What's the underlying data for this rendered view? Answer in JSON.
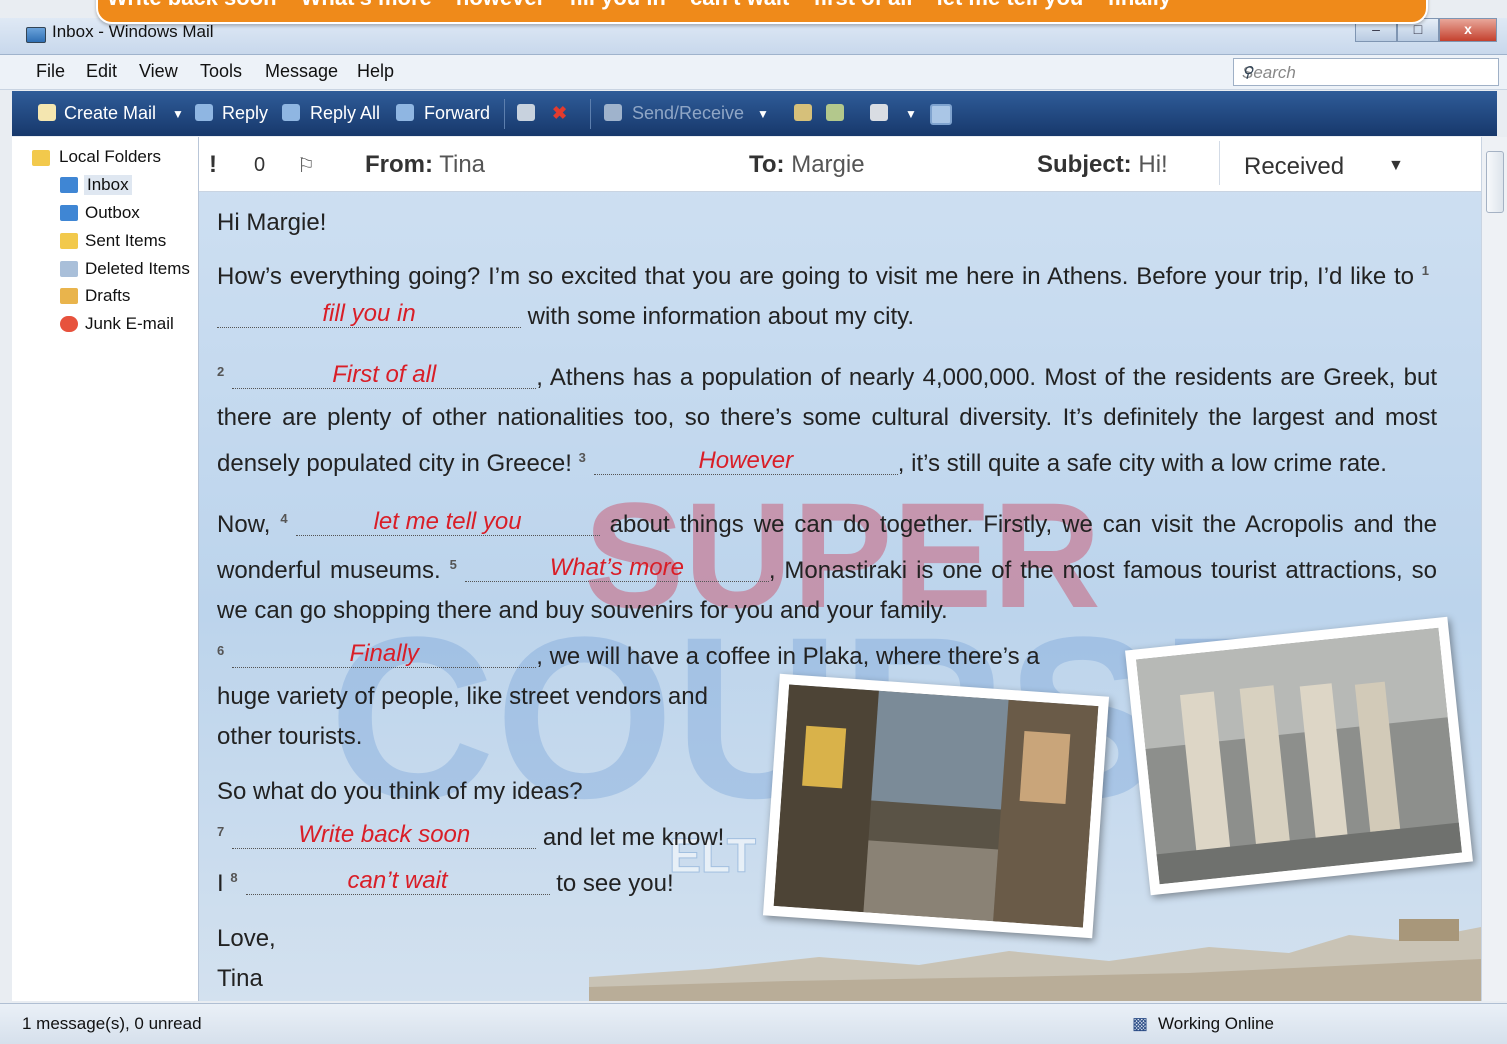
{
  "banner": {
    "items": [
      "Write back soon",
      "What's more",
      "however",
      "fill you in",
      "can't wait",
      "first of all",
      "let me tell you",
      "finally"
    ]
  },
  "window": {
    "title": "Inbox - Windows Mail",
    "buttons": {
      "minimize": "–",
      "maximize": "□",
      "close": "x"
    }
  },
  "menu": {
    "file": "File",
    "edit": "Edit",
    "view": "View",
    "tools": "Tools",
    "message": "Message",
    "help": "Help",
    "search_placeholder": "Search"
  },
  "toolbar": {
    "create_mail": "Create Mail",
    "reply": "Reply",
    "reply_all": "Reply All",
    "forward": "Forward",
    "send_receive": "Send/Receive"
  },
  "folders": {
    "root": "Local Folders",
    "items": [
      "Inbox",
      "Outbox",
      "Sent Items",
      "Deleted Items",
      "Drafts",
      "Junk E-mail"
    ]
  },
  "header": {
    "from_label": "From:",
    "from": "Tina",
    "to_label": "To:",
    "to": "Margie",
    "subject_label": "Subject:",
    "subject": "Hi!",
    "received": "Received",
    "col_importance": "!",
    "col_attachment": "0",
    "col_flag": "⚐"
  },
  "email": {
    "greeting": "Hi Margie!",
    "p1_a": "How’s everything going? I’m so excited that you are going to visit me here in Athens. Before your trip, I’d like to",
    "p1_b": "with some information about my city.",
    "p2_b": ", Athens has a population of nearly 4,000,000. Most of the residents are Greek, but there are plenty of other nationalities too, so there’s some cultural diversity. It’s definitely the largest and most densely populated city in Greece!",
    "p2_c": ", it’s still quite a safe city with a low crime rate.",
    "p3_a": "Now,",
    "p3_b": "about things we can do together. Firstly, we can visit the Acropolis and the wonderful museums.",
    "p3_c": ", Monastiraki is one of the most famous tourist attractions, so we can go shopping there and buy souvenirs for you and your family.",
    "p3_d": ", we will have a coffee in Plaka, where there’s a",
    "p3_e": "huge variety of people, like street vendors and",
    "p3_f": "other tourists.",
    "p4_a": "So what do you think of my ideas?",
    "p4_b": "and let me know!",
    "p4_c": "I",
    "p4_d": "to see you!",
    "love": "Love,",
    "sign": "Tina",
    "nums": [
      "1",
      "2",
      "3",
      "4",
      "5",
      "6",
      "7",
      "8"
    ],
    "answers": [
      "fill you in",
      "First of all",
      "However",
      "let me tell you",
      "What’s more",
      "Finally",
      "Write back soon",
      "can’t wait"
    ]
  },
  "watermark": {
    "super": "SUPER",
    "course": "COURSE",
    "elt": "ELT PUBLISHING"
  },
  "status": {
    "count": "1 message(s), 0 unread",
    "online": "Working Online"
  }
}
